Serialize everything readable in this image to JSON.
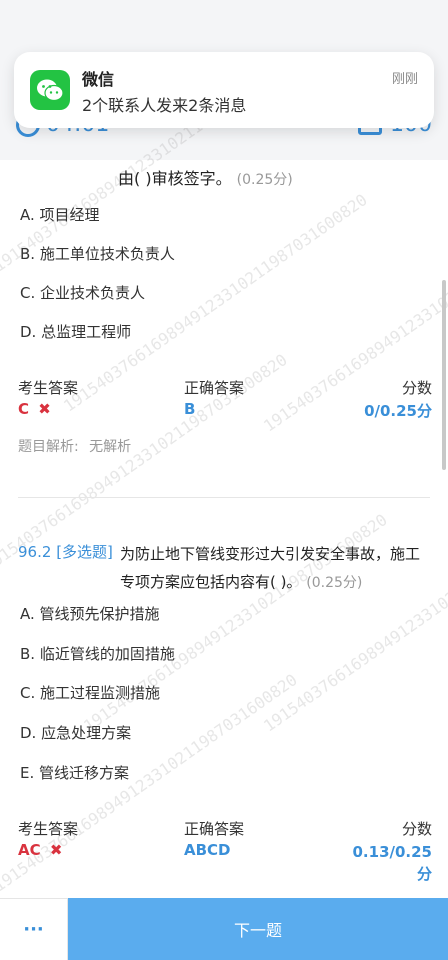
{
  "header": {
    "timer": "04:01",
    "count": "100"
  },
  "notification": {
    "app_name": "微信",
    "message": "2个联系人发来2条消息",
    "time": "刚刚"
  },
  "question_95": {
    "text_tail": "由( )审核签字。",
    "score": "(0.25分)",
    "options": [
      "A. 项目经理",
      "B. 施工单位技术负责人",
      "C. 企业技术负责人",
      "D. 总监理工程师"
    ],
    "labels": {
      "your_answer": "考生答案",
      "correct_answer": "正确答案",
      "score": "分数"
    },
    "your_answer": "C",
    "correct_answer": "B",
    "score_value": "0/0.25分",
    "analysis_label": "题目解析:",
    "analysis_value": "无解析"
  },
  "question_96_2": {
    "number": "96.2",
    "type": "[多选题]",
    "text": "为防止地下管线变形过大引发安全事故，施工专项方案应包括内容有( )。",
    "score": "(0.25分)",
    "options": [
      "A. 管线预先保护措施",
      "B. 临近管线的加固措施",
      "C. 施工过程监测措施",
      "D. 应急处理方案",
      "E. 管线迁移方案"
    ],
    "labels": {
      "your_answer": "考生答案",
      "correct_answer": "正确答案",
      "score": "分数"
    },
    "your_answer": "AC",
    "correct_answer": "ABCD",
    "score_value": "0.13/0.25",
    "score_unit": "分"
  },
  "bottom": {
    "more_label": "···",
    "next_label": "下一题"
  },
  "watermark": "19154037661698949123310211987031600820",
  "colors": {
    "accent": "#3a8fd8",
    "wrong": "#d9333f",
    "next_button": "#5aacee",
    "wechat": "#23c343"
  }
}
